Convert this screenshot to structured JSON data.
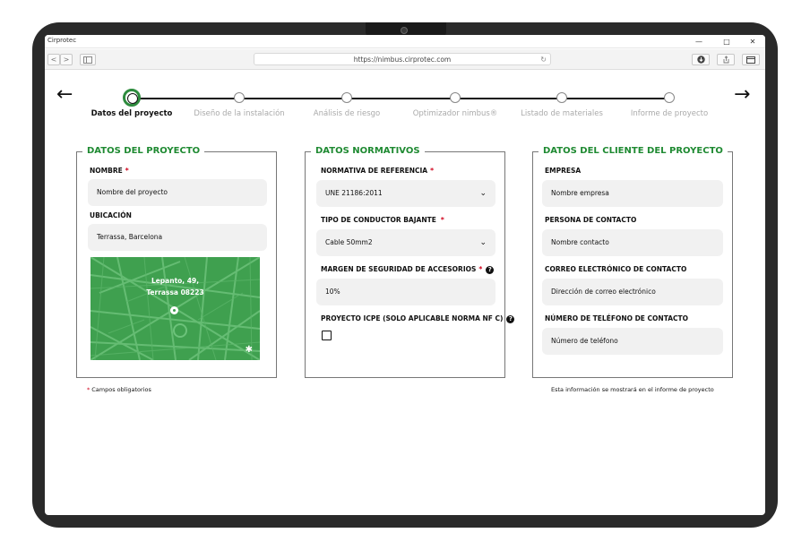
{
  "window": {
    "app_title": "Cirprotec",
    "minimize": "—",
    "maximize": "□",
    "close": "✕"
  },
  "browser": {
    "url": "https://nimbus.cirprotec.com",
    "back": "<",
    "forward": ">"
  },
  "stepper": {
    "steps": [
      {
        "label": "Datos del proyecto",
        "active": true
      },
      {
        "label": "Diseño de la instalación",
        "active": false
      },
      {
        "label": "Análisis de riesgo",
        "active": false
      },
      {
        "label": "Optimizador nimbus®",
        "active": false
      },
      {
        "label": "Listado de materiales",
        "active": false
      },
      {
        "label": "Informe de proyecto",
        "active": false
      }
    ],
    "prev_arrow": "←",
    "next_arrow": "→"
  },
  "project": {
    "title": "DATOS DEL PROYECTO",
    "name_label": "NOMBRE",
    "name_value": "Nombre del proyecto",
    "location_label": "UBICACIÓN",
    "location_value": "Terrassa, Barcelona",
    "map_address_line1": "Lepanto, 49,",
    "map_address_line2": "Terrassa 08223"
  },
  "normative": {
    "title": "DATOS NORMATIVOS",
    "reference_label": "NORMATIVA DE REFERENCIA",
    "reference_value": "UNE 21186:2011",
    "conductor_label": "TIPO DE CONDUCTOR BAJANTE",
    "conductor_value": "Cable 50mm2",
    "margin_label": "MARGEN DE SEGURIDAD DE ACCESORIOS",
    "margin_value": "10%",
    "icpe_label": "PROYECTO ICPE (SOLO APLICABLE NORMA NF C)",
    "icpe_checked": false
  },
  "client": {
    "title": "DATOS DEL CLIENTE DEL PROYECTO",
    "company_label": "EMPRESA",
    "company_value": "Nombre empresa",
    "contact_label": "PERSONA DE CONTACTO",
    "contact_value": "Nombre contacto",
    "email_label": "CORREO ELECTRÓNICO DE CONTACTO",
    "email_value": "Dirección de correo electrónico",
    "phone_label": "NÚMERO DE TELÉFONO DE CONTACTO",
    "phone_value": "Número de teléfono"
  },
  "footer": {
    "required_star": "*",
    "required_note": "Campos obligatorios",
    "client_note": "Esta información se mostrará en el informe de proyecto"
  },
  "colors": {
    "accent_green": "#1f8a32",
    "map_green": "#3fa04f",
    "required_red": "#d0021b"
  }
}
